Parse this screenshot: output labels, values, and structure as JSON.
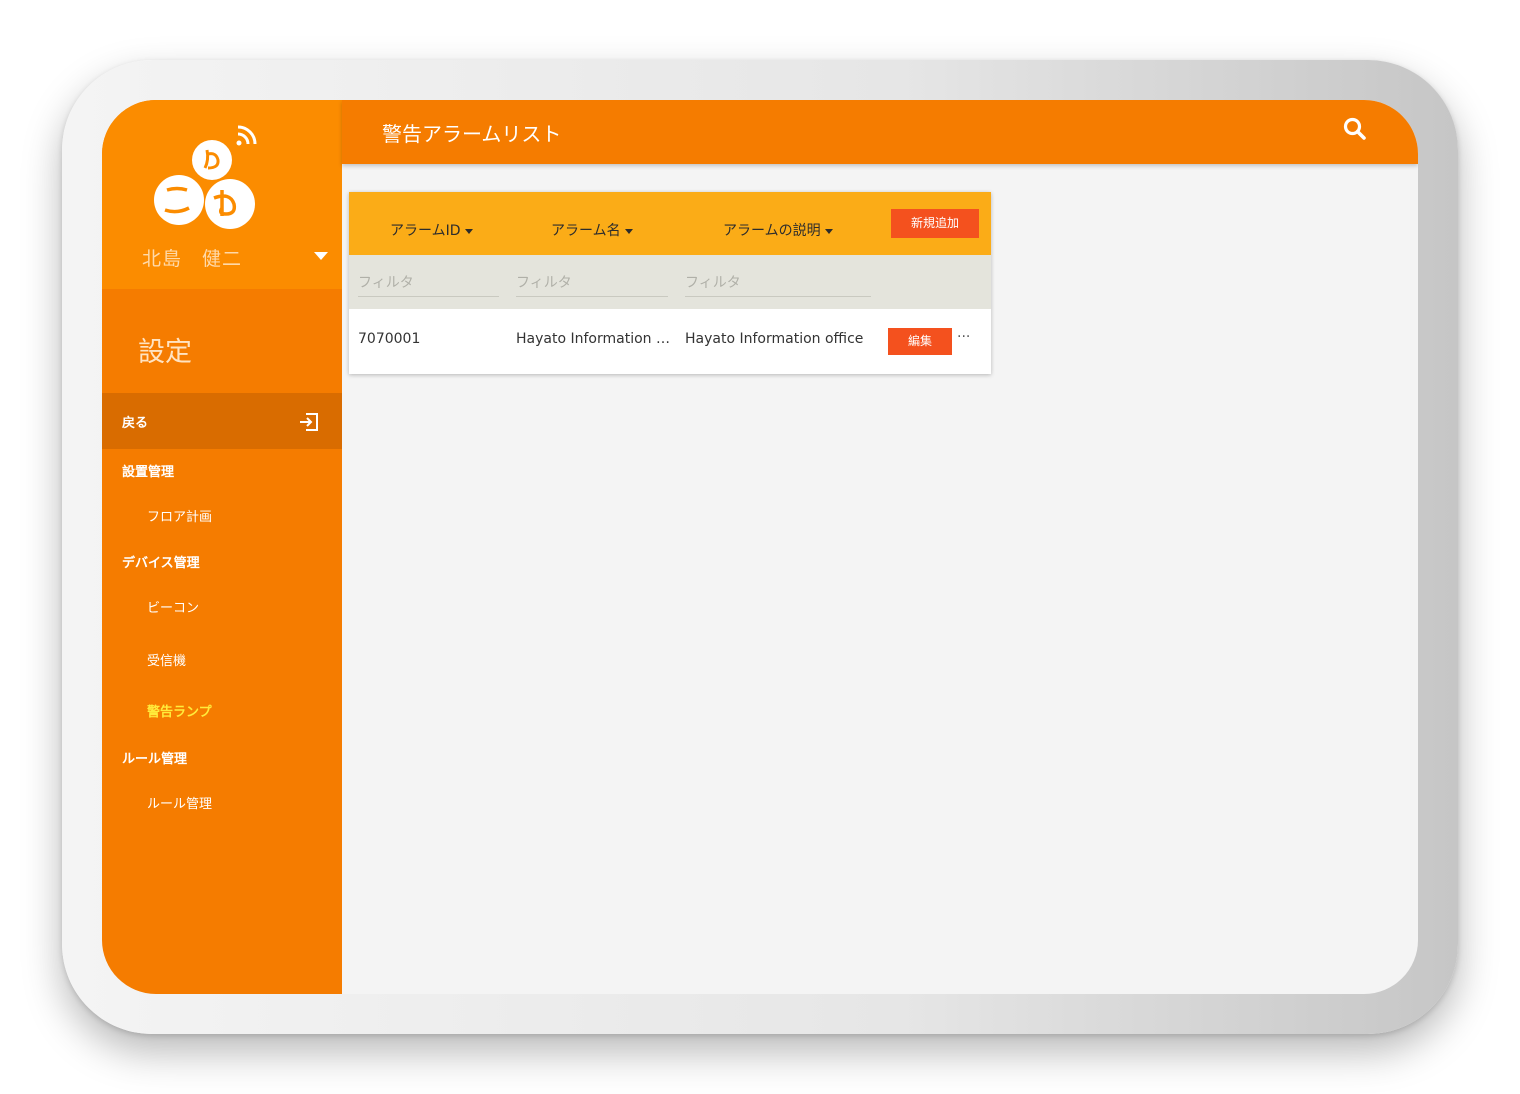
{
  "user": {
    "name": "北島　健二"
  },
  "sidebar": {
    "section_title": "設定",
    "back_label": "戻る",
    "groups": [
      {
        "label": "設置管理",
        "items": [
          {
            "label": "フロア計画"
          }
        ]
      },
      {
        "label": "デバイス管理",
        "items": [
          {
            "label": "ビーコン"
          },
          {
            "label": "受信機"
          },
          {
            "label": "警告ランプ",
            "active": true
          }
        ]
      },
      {
        "label": "ルール管理",
        "items": [
          {
            "label": "ルール管理"
          }
        ]
      }
    ]
  },
  "header": {
    "title": "警告アラームリスト"
  },
  "table": {
    "columns": [
      {
        "label": "アラームID"
      },
      {
        "label": "アラーム名"
      },
      {
        "label": "アラームの説明"
      }
    ],
    "add_button": "新規追加",
    "filter_placeholder": "フィルタ",
    "rows": [
      {
        "id": "7070001",
        "name": "Hayato Information office",
        "description": "Hayato Information office",
        "edit_label": "編集",
        "more_label": "···"
      }
    ]
  },
  "colors": {
    "primary": "#f57c00",
    "header_table": "#fbac17",
    "button": "#f4511e",
    "active_nav": "#ffeb3b"
  }
}
